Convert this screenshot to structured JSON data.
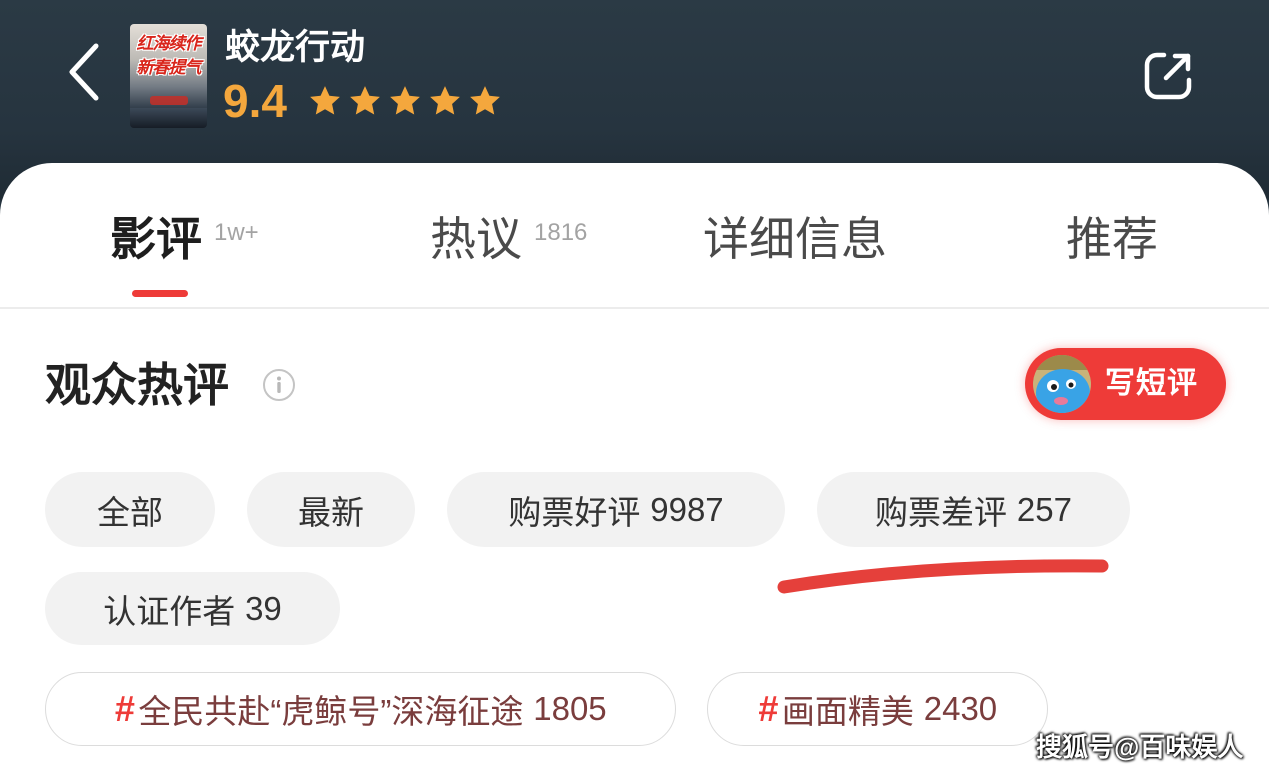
{
  "header": {
    "title": "蛟龙行动",
    "rating": "9.4",
    "stars_filled": 5,
    "stars_total": 5,
    "poster_text": [
      "红海续作",
      "新春提气"
    ]
  },
  "icons": {
    "back": "chevron-left-icon",
    "share": "share-icon",
    "star": "star-icon",
    "info": "info-icon"
  },
  "tabs": [
    {
      "label": "影评",
      "count": "1w+",
      "active": true
    },
    {
      "label": "热议",
      "count": "1816",
      "active": false
    },
    {
      "label": "详细信息",
      "active": false
    },
    {
      "label": "推荐",
      "active": false
    }
  ],
  "section": {
    "title": "观众热评",
    "write_button": "写短评"
  },
  "filters": [
    {
      "label": "全部"
    },
    {
      "label": "最新"
    },
    {
      "label": "购票好评",
      "count": "9987"
    },
    {
      "label": "购票差评",
      "count": "257"
    },
    {
      "label": "认证作者",
      "count": "39"
    }
  ],
  "topics": [
    {
      "hash": "#",
      "label": "全民共赴“虎鲸号”深海征途",
      "count": "1805"
    },
    {
      "hash": "#",
      "label": "画面精美",
      "count": "2430"
    }
  ],
  "watermark": "搜狐号@百味娱人",
  "theme": {
    "header_bg": "#26343f",
    "accent_red": "#ee3b38",
    "rating_gold": "#f4a73d",
    "chip_bg": "#f2f2f2",
    "topic_text": "#7a3d3d",
    "annotation_red": "#e5403b"
  }
}
